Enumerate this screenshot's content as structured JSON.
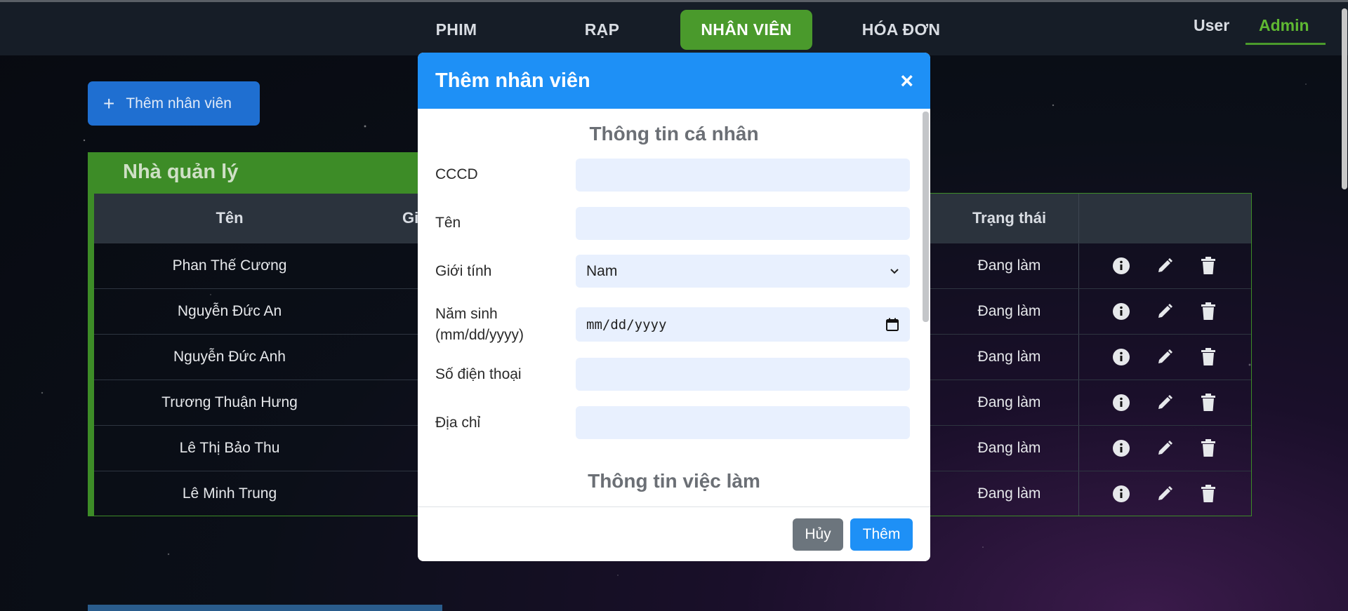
{
  "nav": {
    "items": [
      {
        "label": "PHIM"
      },
      {
        "label": "RẠP"
      },
      {
        "label": "NHÂN VIÊN"
      },
      {
        "label": "HÓA ĐƠN"
      }
    ],
    "active_index": 2,
    "user_label": "User",
    "admin_label": "Admin"
  },
  "page": {
    "add_button_label": "Thêm nhân viên",
    "section_title": "Nhà quản lý",
    "columns": [
      "Tên",
      "Gi",
      "Trạng thái"
    ],
    "rows": [
      {
        "name": "Phan Thế Cương",
        "status": "Đang làm"
      },
      {
        "name": "Nguyễn Đức An",
        "status": "Đang làm"
      },
      {
        "name": "Nguyễn Đức Anh",
        "status": "Đang làm"
      },
      {
        "name": "Trương Thuận Hưng",
        "status": "Đang làm"
      },
      {
        "name": "Lê Thị Bảo Thu",
        "status": "Đang làm"
      },
      {
        "name": "Lê Minh Trung",
        "status": "Đang làm"
      }
    ]
  },
  "modal": {
    "title": "Thêm nhân viên",
    "close_symbol": "×",
    "section_personal": "Thông tin cá nhân",
    "section_job": "Thông tin việc làm",
    "fields": {
      "cccd": {
        "label": "CCCD",
        "value": ""
      },
      "ten": {
        "label": "Tên",
        "value": ""
      },
      "gioi_tinh": {
        "label": "Giới tính",
        "value": "Nam"
      },
      "nam_sinh": {
        "label_line1": "Năm sinh",
        "label_line2": "(mm/dd/yyyy)",
        "value": "mm/dd/yyyy"
      },
      "so_dien_thoai": {
        "label": "Số điện thoại",
        "value": ""
      },
      "dia_chi": {
        "label": "Địa chỉ",
        "value": ""
      }
    },
    "cancel_label": "Hủy",
    "submit_label": "Thêm"
  },
  "icons": {
    "info": "info-icon",
    "edit": "pencil-icon",
    "delete": "trash-icon"
  },
  "colors": {
    "accent_green": "#4a9a2c",
    "modal_blue": "#1e90f6",
    "add_button_blue": "#1f6fd1"
  }
}
